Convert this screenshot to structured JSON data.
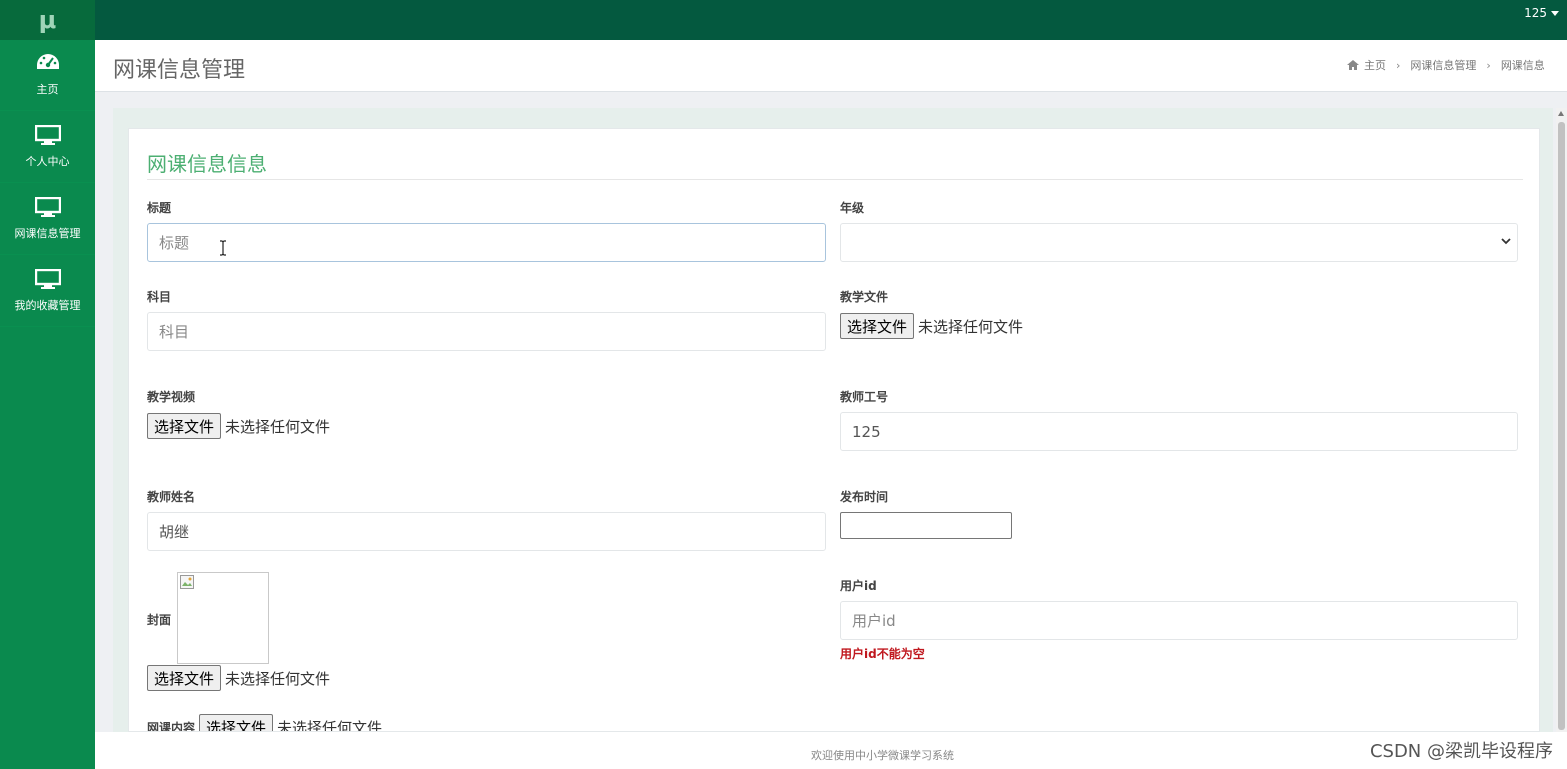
{
  "sidebar": {
    "logo": "μ",
    "items": [
      {
        "label": "主页",
        "icon": "dashboard-icon"
      },
      {
        "label": "个人中心",
        "icon": "monitor-icon"
      },
      {
        "label": "网课信息管理",
        "icon": "monitor-icon"
      },
      {
        "label": "我的收藏管理",
        "icon": "monitor-icon"
      }
    ]
  },
  "topbar": {
    "user": "125"
  },
  "header": {
    "title": "网课信息管理",
    "breadcrumb": [
      "主页",
      "网课信息管理",
      "网课信息"
    ]
  },
  "form": {
    "title": "网课信息信息",
    "fields": {
      "title": {
        "label": "标题",
        "placeholder": "标题",
        "value": ""
      },
      "grade": {
        "label": "年级",
        "value": ""
      },
      "subject": {
        "label": "科目",
        "placeholder": "科目",
        "value": ""
      },
      "teaching_file": {
        "label": "教学文件",
        "button": "选择文件",
        "status": "未选择任何文件"
      },
      "teaching_video": {
        "label": "教学视频",
        "button": "选择文件",
        "status": "未选择任何文件"
      },
      "teacher_id": {
        "label": "教师工号",
        "value": "125"
      },
      "teacher_name": {
        "label": "教师姓名",
        "value": "胡继"
      },
      "publish_time": {
        "label": "发布时间",
        "value": ""
      },
      "cover": {
        "label": "封面",
        "button": "选择文件",
        "status": "未选择任何文件"
      },
      "user_id": {
        "label": "用户id",
        "placeholder": "用户id",
        "error": "用户id不能为空"
      },
      "content": {
        "label": "网课内容",
        "button": "选择文件",
        "status": "未选择任何文件"
      }
    }
  },
  "footer": {
    "text": "欢迎使用中小学微课学习系统"
  },
  "watermark": "CSDN @梁凯毕设程序",
  "colors": {
    "sidebar": "#0a8a4e",
    "topbar": "#04593f",
    "accent_title": "#4caf72",
    "error": "#c0181f"
  }
}
